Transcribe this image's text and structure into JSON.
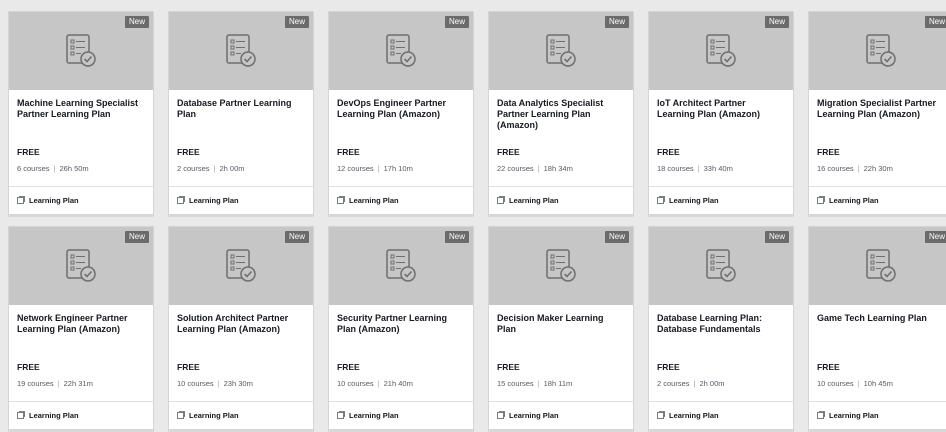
{
  "badge_label": "New",
  "price_label": "FREE",
  "footer_label": "Learning Plan",
  "cards": [
    {
      "title": "Machine Learning Specialist Partner Learning Plan",
      "courses": "6 courses",
      "duration": "26h 50m"
    },
    {
      "title": "Database Partner Learning Plan",
      "courses": "2 courses",
      "duration": "2h 00m"
    },
    {
      "title": "DevOps Engineer Partner Learning Plan (Amazon)",
      "courses": "12 courses",
      "duration": "17h 10m"
    },
    {
      "title": "Data Analytics Specialist Partner Learning Plan (Amazon)",
      "courses": "22 courses",
      "duration": "18h 34m"
    },
    {
      "title": "IoT Architect Partner Learning Plan (Amazon)",
      "courses": "18 courses",
      "duration": "33h 40m"
    },
    {
      "title": "Migration Specialist Partner Learning Plan (Amazon)",
      "courses": "16 courses",
      "duration": "22h 30m"
    },
    {
      "title": "Network Engineer Partner Learning Plan (Amazon)",
      "courses": "19 courses",
      "duration": "22h 31m"
    },
    {
      "title": "Solution Architect Partner Learning Plan (Amazon)",
      "courses": "10 courses",
      "duration": "23h 30m"
    },
    {
      "title": "Security Partner Learning Plan (Amazon)",
      "courses": "10 courses",
      "duration": "21h 40m"
    },
    {
      "title": "Decision Maker Learning Plan",
      "courses": "15 courses",
      "duration": "18h 11m"
    },
    {
      "title": "Database Learning Plan: Database Fundamentals",
      "courses": "2 courses",
      "duration": "2h 00m"
    },
    {
      "title": "Game Tech Learning Plan",
      "courses": "10 courses",
      "duration": "10h 45m"
    }
  ]
}
